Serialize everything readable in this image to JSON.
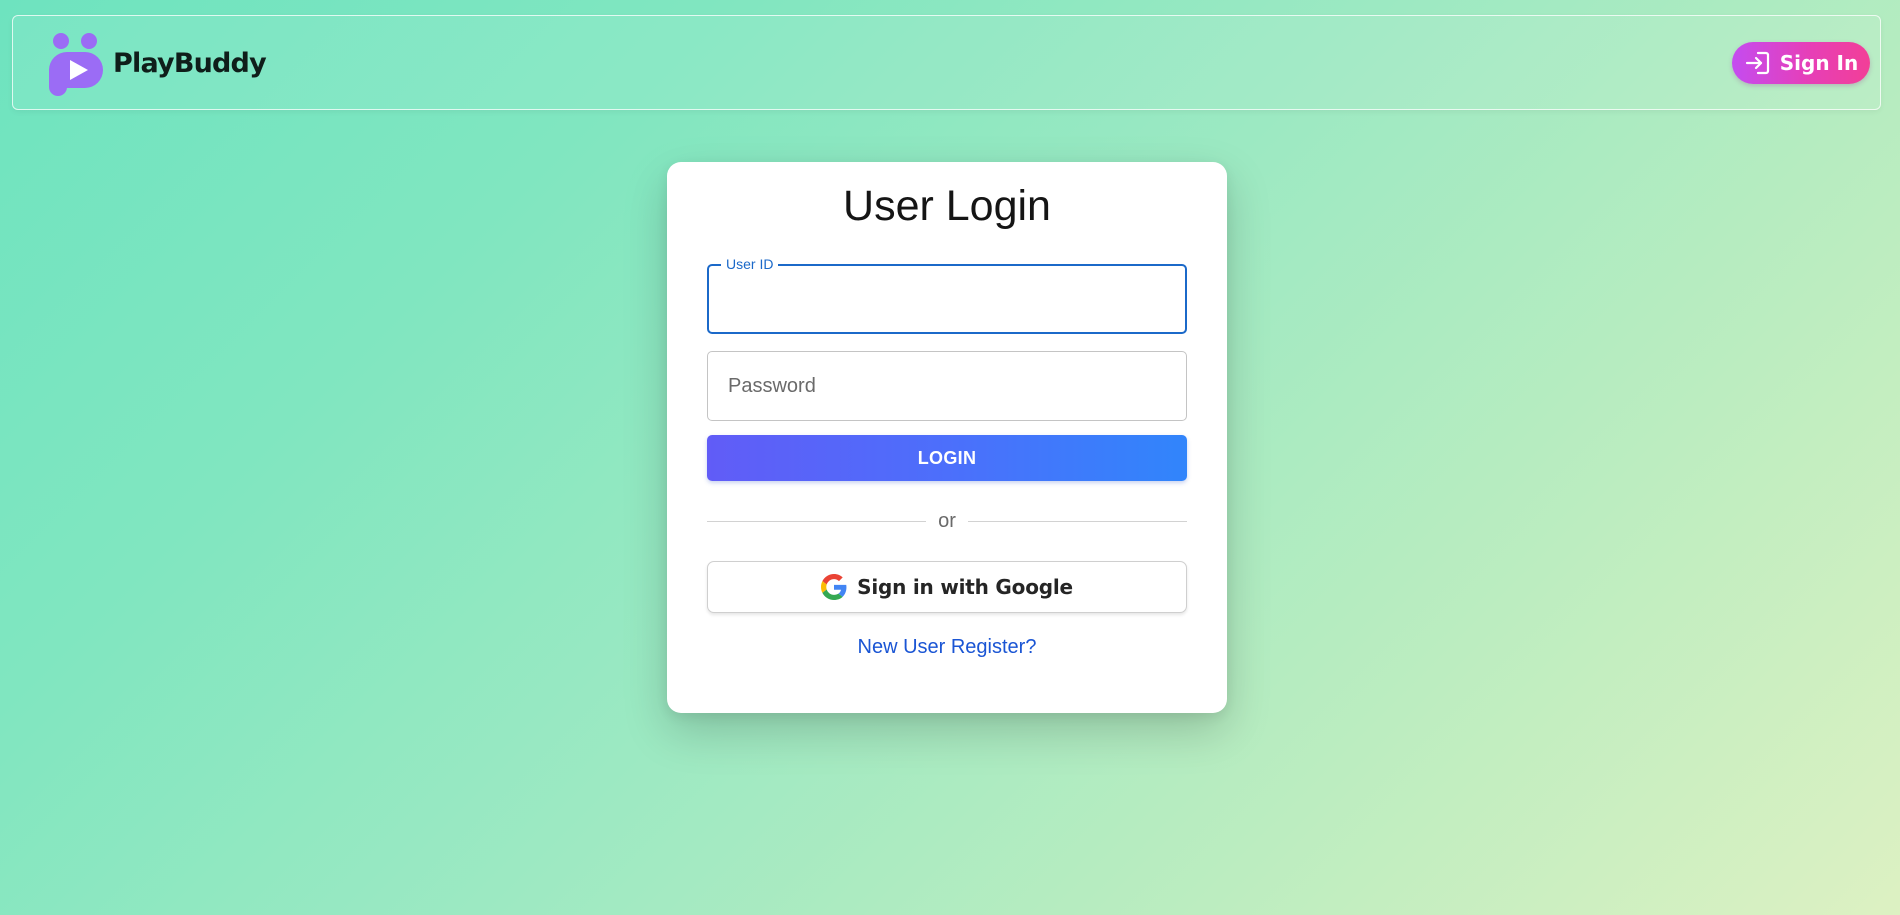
{
  "header": {
    "brand": "PlayBuddy",
    "signin_label": "Sign In"
  },
  "login": {
    "title": "User Login",
    "user_id_label": "User ID",
    "user_id_value": "",
    "password_placeholder": "Password",
    "password_value": "",
    "login_button": "LOGIN",
    "divider": "or",
    "google_button": "Sign in with Google",
    "register_link": "New User Register?"
  },
  "icons": {
    "logo": "playbuddy-logo-icon",
    "signin": "login-arrow-icon",
    "google": "google-icon"
  },
  "colors": {
    "brand_purple": "#9b6cf5",
    "signin_gradient_start": "#c44cf0",
    "signin_gradient_end": "#f23f97",
    "login_gradient_start": "#615cf7",
    "login_gradient_end": "#3185fb",
    "focus_blue": "#1b69c9",
    "link_blue": "#1a55d4"
  }
}
